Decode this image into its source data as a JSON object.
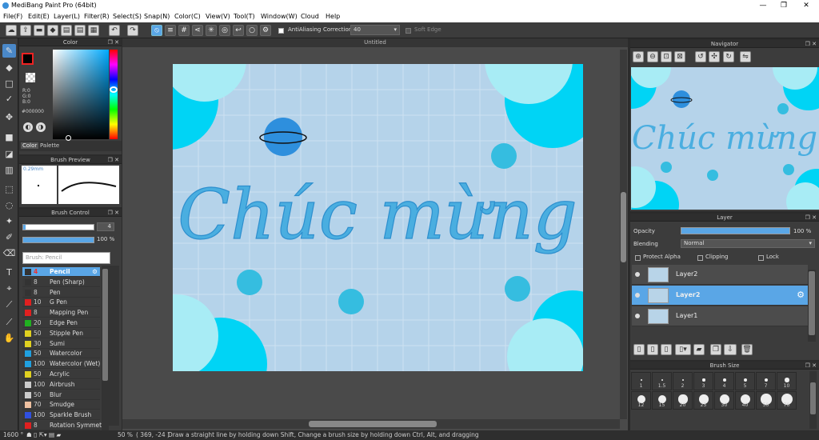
{
  "window": {
    "title": "MediBang Paint Pro (64bit)",
    "minimize": "—",
    "maximize": "❐",
    "close": "✕"
  },
  "menu": [
    "File(F)",
    "Edit(E)",
    "Layer(L)",
    "Filter(R)",
    "Select(S)",
    "Snap(N)",
    "Color(C)",
    "View(V)",
    "Tool(T)",
    "Window(W)",
    "Cloud",
    "Help"
  ],
  "toolbar": {
    "antialiasing_label": "AntiAliasing",
    "correction_label": "Correction",
    "correction_value": "40",
    "soft_edge_label": "Soft Edge"
  },
  "color_panel": {
    "title": "Color",
    "r": "R:0",
    "g": "G:0",
    "b": "B:0",
    "hex": "#000000",
    "tab_color": "Color",
    "tab_palette": "Palette",
    "primary_color": "#000000",
    "accent": "#5aa6e6"
  },
  "brush_preview": {
    "title": "Brush Preview",
    "size_label": "0.29mm"
  },
  "brush_control": {
    "title": "Brush Control",
    "size_value": "4",
    "opacity_value": "100 %",
    "search_placeholder": "Brush: Pencil",
    "brushes": [
      {
        "size": "4",
        "name": "Pencil",
        "color": "#333333",
        "selected": true
      },
      {
        "size": "8",
        "name": "Pen (Sharp)",
        "color": "#333333"
      },
      {
        "size": "8",
        "name": "Pen",
        "color": "#333333"
      },
      {
        "size": "10",
        "name": "G Pen",
        "color": "#e02020"
      },
      {
        "size": "8",
        "name": "Mapping Pen",
        "color": "#e02020"
      },
      {
        "size": "20",
        "name": "Edge Pen",
        "color": "#20b020"
      },
      {
        "size": "50",
        "name": "Stipple Pen",
        "color": "#e0d020"
      },
      {
        "size": "30",
        "name": "Sumi",
        "color": "#e0d020"
      },
      {
        "size": "50",
        "name": "Watercolor",
        "color": "#20a0e0"
      },
      {
        "size": "100",
        "name": "Watercolor (Wet)",
        "color": "#20a0e0"
      },
      {
        "size": "50",
        "name": "Acrylic",
        "color": "#e0d020"
      },
      {
        "size": "100",
        "name": "Airbrush",
        "color": "#cccccc"
      },
      {
        "size": "50",
        "name": "Blur",
        "color": "#cccccc"
      },
      {
        "size": "70",
        "name": "Smudge",
        "color": "#eec0a0"
      },
      {
        "size": "100",
        "name": "Sparkle Brush",
        "color": "#3050e0"
      },
      {
        "size": "8",
        "name": "Rotation Symmetr",
        "color": "#e02020"
      }
    ]
  },
  "document": {
    "tab_title": "Untitled",
    "canvas_text": "Chúc mừng",
    "bg_color": "#b5d3ea",
    "circle_color": "#00d4f5",
    "circle_light": "#a8ecf5",
    "dot_color": "#35bde0",
    "planet_color": "#2e8fdd",
    "text_color": "#4aaee0"
  },
  "navigator": {
    "title": "Navigator"
  },
  "layer_panel": {
    "title": "Layer",
    "opacity_label": "Opacity",
    "opacity_value": "100 %",
    "blending_label": "Blending",
    "blending_value": "Normal",
    "protect_alpha": "Protect Alpha",
    "clipping": "Clipping",
    "lock": "Lock",
    "layers": [
      {
        "name": "Layer2",
        "selected": false
      },
      {
        "name": "Layer2",
        "selected": true
      },
      {
        "name": "Layer1",
        "selected": false
      }
    ]
  },
  "brush_size": {
    "title": "Brush Size",
    "sizes_row1": [
      "1",
      "1.5",
      "2",
      "3",
      "4",
      "5",
      "7",
      "10"
    ],
    "sizes_row2": [
      "12",
      "15",
      "20",
      "25",
      "30",
      "40",
      "50",
      "70"
    ]
  },
  "status": {
    "zoom": "1600 °",
    "canvas_zoom": "50 %",
    "coords": "( 369, -24 )",
    "hint": "Draw a straight line by holding down Shift, Change a brush size by holding down Ctrl, Alt, and dragging"
  }
}
